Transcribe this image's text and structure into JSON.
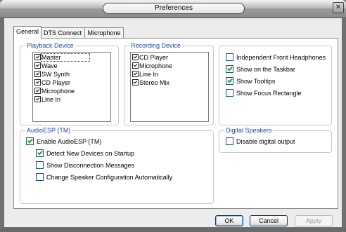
{
  "window": {
    "title": "Preferences",
    "close_glyph": "✕"
  },
  "tabs": [
    {
      "label": "General",
      "active": true
    },
    {
      "label": "DTS Connect",
      "active": false
    },
    {
      "label": "Microphone",
      "active": false
    }
  ],
  "playback": {
    "title": "Playback Device",
    "items": [
      "Master",
      "Wave",
      "SW Synth",
      "CD Player",
      "Microphone",
      "Line In"
    ]
  },
  "recording": {
    "title": "Recording Device",
    "items": [
      "CD Player",
      "Microphone",
      "Line In",
      "Stereo Mix"
    ]
  },
  "options": [
    {
      "label": "Independent Front Headphones",
      "checked": false
    },
    {
      "label": "Show on the Taskbar",
      "checked": true
    },
    {
      "label": "Show Tooltips",
      "checked": true
    },
    {
      "label": "Show Focus Rectangle",
      "checked": false
    }
  ],
  "audioesp": {
    "title": "AudioESP (TM)",
    "enable": {
      "label": "Enable AudioESP (TM)",
      "checked": true
    },
    "detect": {
      "label": "Detect New Devices on Startup",
      "checked": true
    },
    "disconnect": {
      "label": "Show Disconnection Messages",
      "checked": false
    },
    "speaker": {
      "label": "Change Speaker Configuration Automatically",
      "checked": false
    }
  },
  "digital": {
    "title": "Digital Speakers",
    "disable": {
      "label": "Disable digital output",
      "checked": false
    }
  },
  "buttons": {
    "ok": "OK",
    "cancel": "Cancel",
    "apply": "Apply"
  },
  "colors": {
    "group_title": "#1f4aa8",
    "check_mark": "#21a121"
  }
}
